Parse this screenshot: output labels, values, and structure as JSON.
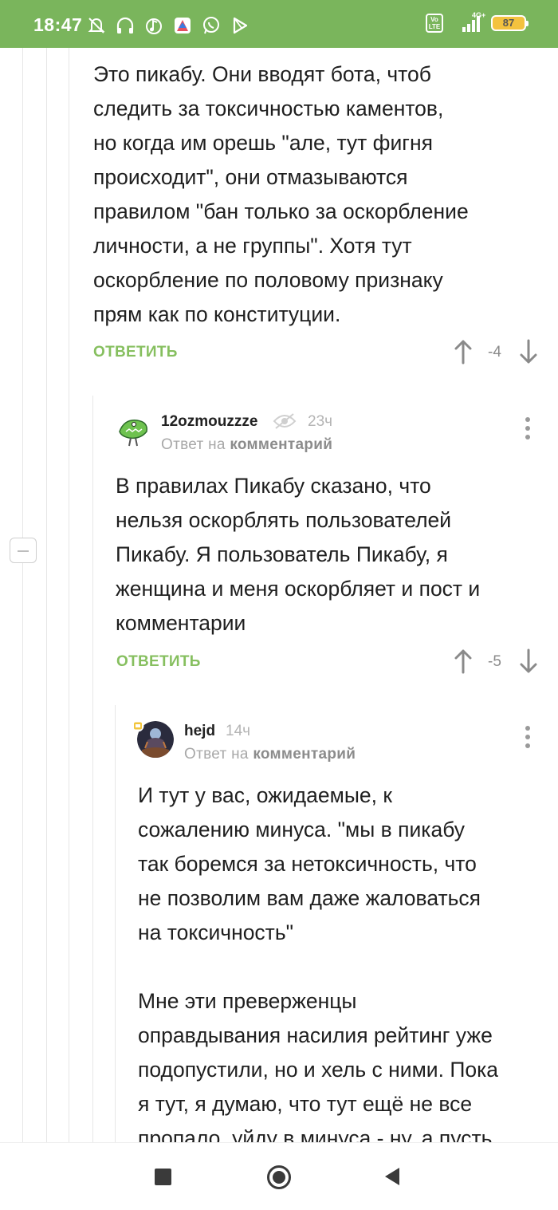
{
  "status_bar": {
    "time": "18:47",
    "network": "4G+",
    "volte": "Vo LTE",
    "battery": "87",
    "icons": [
      "mute-bell-icon",
      "headphones-icon",
      "music-icon",
      "app-icon",
      "whatsapp-icon",
      "play-store-icon"
    ]
  },
  "comments": [
    {
      "text": "Это пикабу. Они вводят бота, чтоб\nследить за токсичностью каментов,\nно когда им орешь \"але, тут фигня\nпроисходит\", они отмазываются\nправилом \"бан только за оскорбление\nличности, а не группы\". Хотя тут\nоскорбление по половому признаку\nпрям как по конституции.",
      "reply_label": "ОТВЕТИТЬ",
      "rating": "-4"
    },
    {
      "username": "12ozmouzzze",
      "time": "23ч",
      "reply_to_prefix": "Ответ на",
      "reply_to_target": "комментарий",
      "text": "В правилах Пикабу сказано, что\nнельзя оскорблять пользователей\nПикабу. Я пользователь Пикабу, я\nженщина и меня оскорбляет и пост и\nкомментарии",
      "reply_label": "ОТВЕТИТЬ",
      "rating": "-5"
    },
    {
      "username": "hejd",
      "time": "14ч",
      "reply_to_prefix": "Ответ на",
      "reply_to_target": "комментарий",
      "text": "И тут у вас, ожидаемые, к\nсожалению минуса. \"мы в пикабу\nтак боремся за нетоксичность, что\nне позволим вам даже жаловаться\nна токсичность\"\n\nМне эти преверженцы\nоправдывания насилия рейтинг уже\nподопустили, но и хель с ними. Пока\nя тут, я думаю, что тут ещё не все\nпропало, уйду в минуса - ну, а пусть"
    }
  ],
  "colors": {
    "status_bar": "#7ab55c",
    "reply_link": "#86bf5f"
  }
}
